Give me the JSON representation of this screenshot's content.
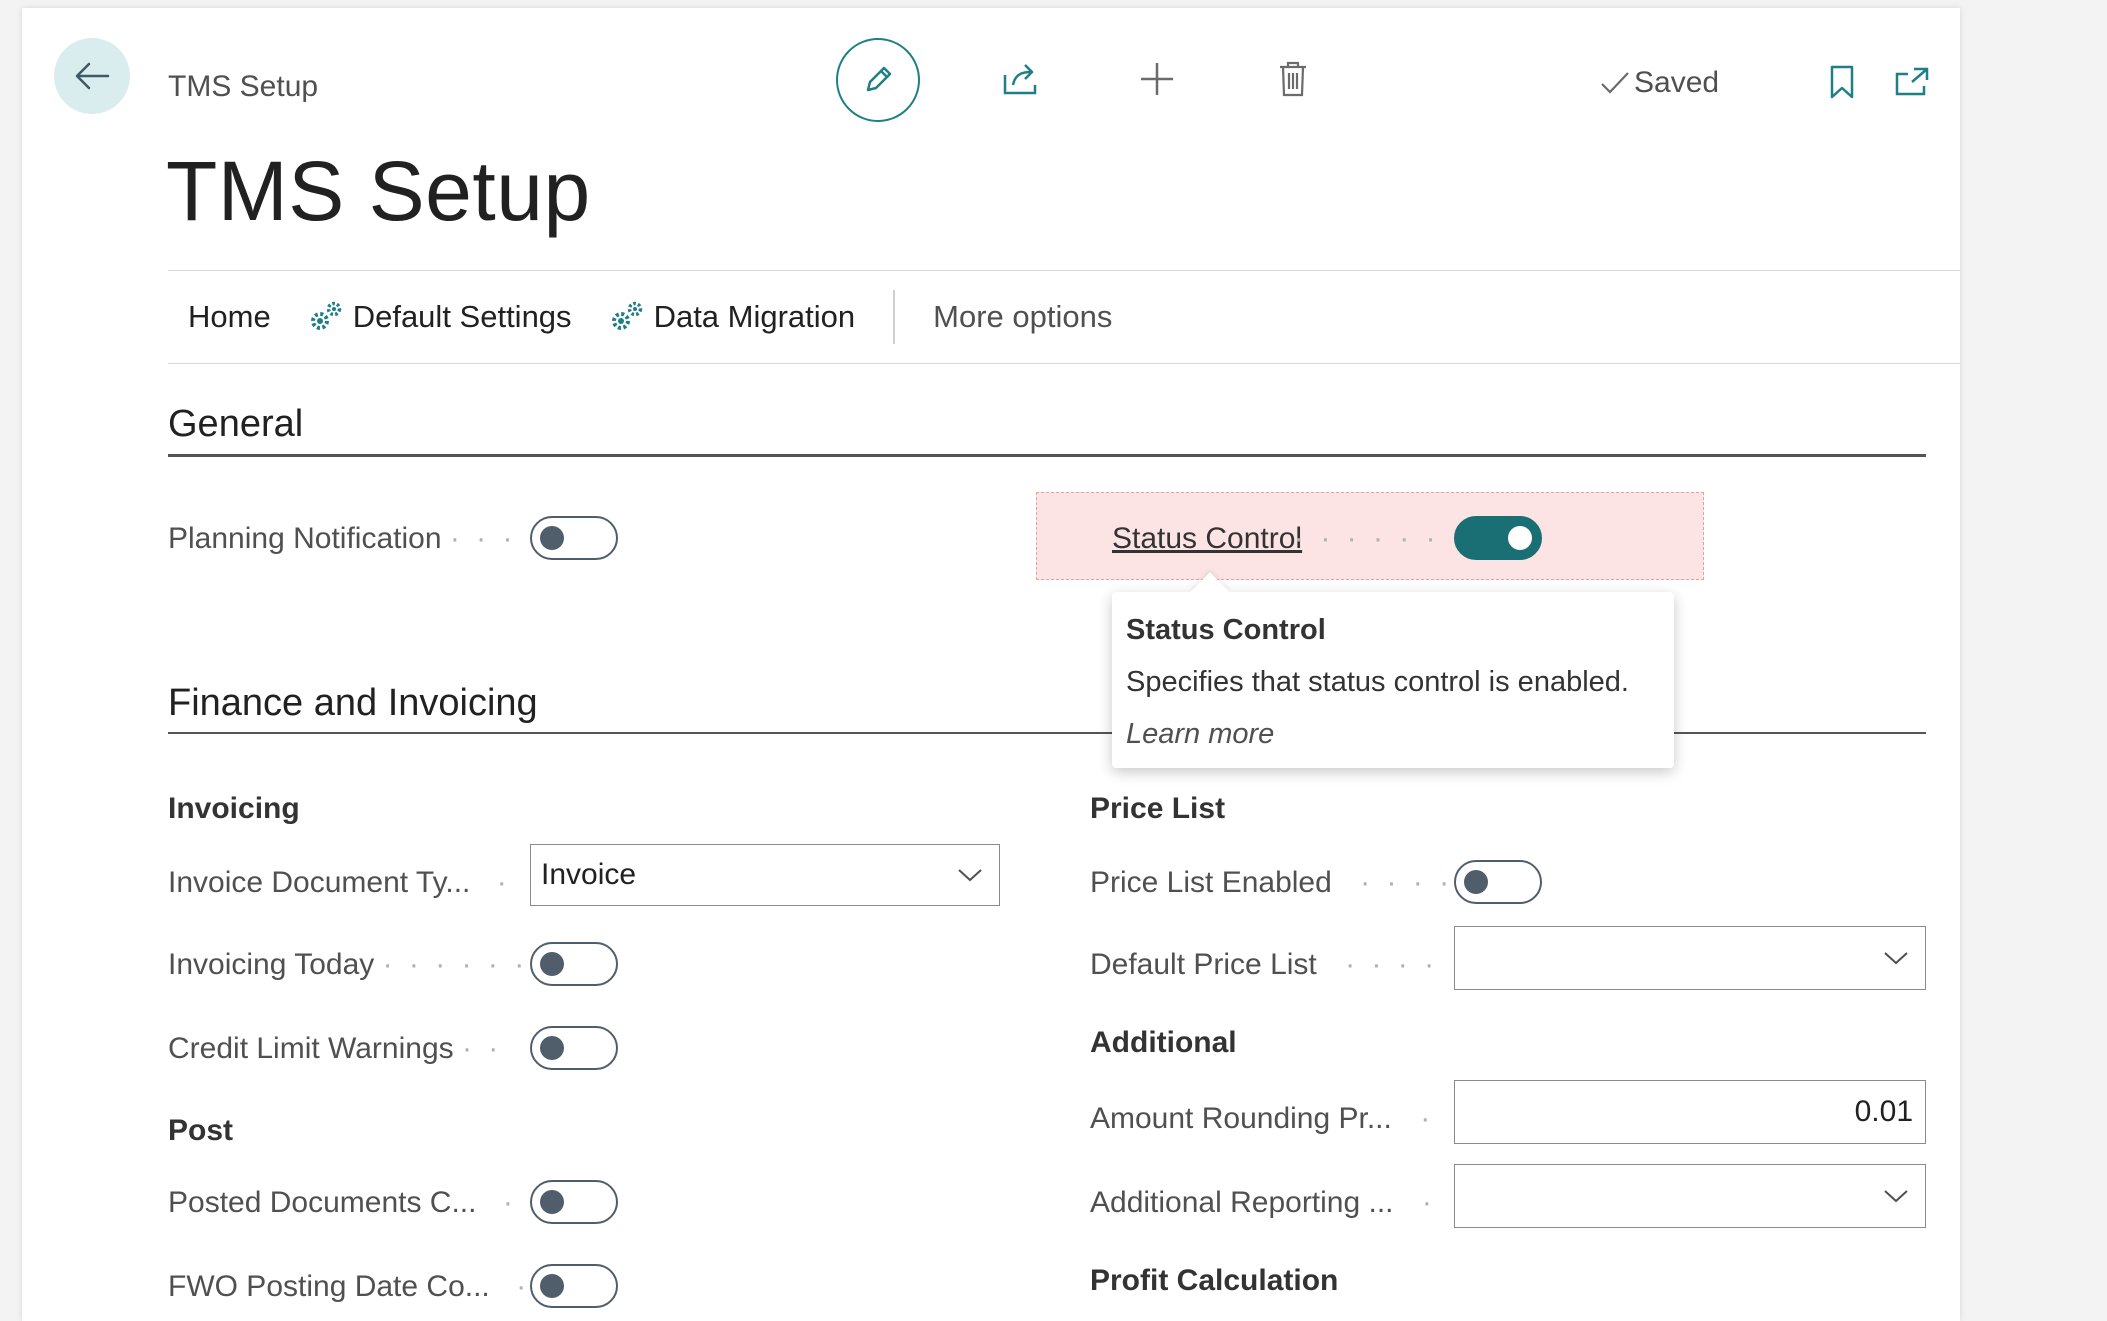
{
  "header": {
    "breadcrumb": "TMS Setup",
    "title": "TMS Setup",
    "saved_label": "Saved"
  },
  "action_bar": {
    "home": "Home",
    "default_settings": "Default Settings",
    "data_migration": "Data Migration",
    "more_options": "More options"
  },
  "general": {
    "title": "General",
    "planning_notification": {
      "label": "Planning Notification",
      "dots": "· · ·",
      "value": false
    },
    "status_control": {
      "label": "Status Control",
      "dots": "· · · · · · · ·",
      "value": true
    }
  },
  "tooltip": {
    "title": "Status Control",
    "description": "Specifies that status control is enabled.",
    "link": "Learn more"
  },
  "finance": {
    "title": "Finance and Invoicing",
    "invoicing": {
      "heading": "Invoicing",
      "invoice_document_type": {
        "label": "Invoice Document Ty...",
        "dots": "·",
        "value": "Invoice"
      },
      "invoicing_today": {
        "label": "Invoicing Today",
        "dots": "· · · · · · ·",
        "value": false
      },
      "credit_limit_warnings": {
        "label": "Credit Limit Warnings",
        "dots": "· ·",
        "value": false
      }
    },
    "post": {
      "heading": "Post",
      "posted_documents": {
        "label": "Posted Documents C...",
        "dots": "·",
        "value": false
      },
      "fwo_posting_date": {
        "label": "FWO Posting Date Co...",
        "dots": "·",
        "value": false
      }
    },
    "price_list": {
      "heading": "Price List",
      "price_list_enabled": {
        "label": "Price List Enabled",
        "dots": "· · · · ·",
        "value": false
      },
      "default_price_list": {
        "label": "Default Price List",
        "dots": "· · · · · ·",
        "value": ""
      }
    },
    "additional": {
      "heading": "Additional",
      "amount_rounding": {
        "label": "Amount Rounding Pr...",
        "dots": "·",
        "value": "0.01"
      },
      "additional_reporting": {
        "label": "Additional Reporting ...",
        "dots": "·",
        "value": ""
      }
    },
    "profit_calculation": {
      "heading": "Profit Calculation"
    }
  },
  "colors": {
    "accent": "#1f7f86",
    "toggle_on": "#1a6f75",
    "highlight": "#fde4e4"
  }
}
